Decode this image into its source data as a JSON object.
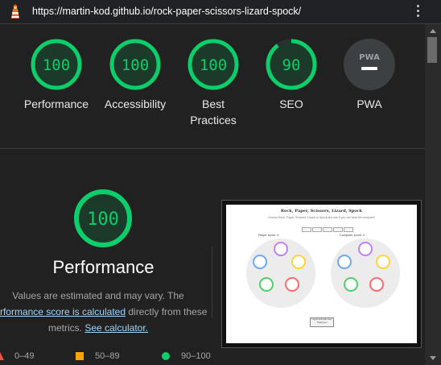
{
  "browser": {
    "url": "https://martin-kod.github.io/rock-paper-scissors-lizard-spock/",
    "logo_icon": "lighthouse-icon",
    "menu_icon": "kebab-menu-icon"
  },
  "colors": {
    "pass": "#0cce6b",
    "average": "#ffa400",
    "fail": "#ff4e42",
    "pwa_gray": "#5f6368"
  },
  "gauges": [
    {
      "score": "100",
      "label": "Performance"
    },
    {
      "score": "100",
      "label": "Accessibility"
    },
    {
      "score": "100",
      "label": "Best Practices"
    },
    {
      "score": "90",
      "label": "SEO"
    },
    {
      "score": "PWA",
      "label": "PWA"
    }
  ],
  "performance": {
    "score": "100",
    "title": "Performance",
    "desc_1": "Values are estimated and may vary. The ",
    "link_score": "performance score is calculated",
    "desc_2": " directly from these metrics. ",
    "link_calc": "See calculator."
  },
  "legend": [
    {
      "range": "0–49"
    },
    {
      "range": "50–89"
    },
    {
      "range": "90–100"
    }
  ],
  "thumbnail": {
    "title": "Rock, Paper, Scissors, Lizard, Spock",
    "subtitle": "Choose Rock, Paper, Scissors, Lizard or Spock and see if you can beat the computer!",
    "player_score": "Player score: 0",
    "computer_score": "Computer score: 0",
    "reset_label": "Logout and start over! Thank you!"
  }
}
